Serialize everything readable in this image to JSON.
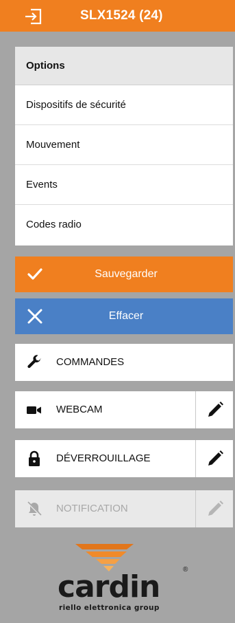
{
  "header": {
    "title": "SLX1524 (24)",
    "exit_icon": "exit-icon",
    "background": "#f07f1f"
  },
  "menu": {
    "heading": "Options",
    "items": [
      {
        "label": "Dispositifs de sécurité"
      },
      {
        "label": "Mouvement"
      },
      {
        "label": "Events"
      },
      {
        "label": "Codes radio"
      }
    ]
  },
  "actions": {
    "save_label": "Sauvegarder",
    "save_icon": "check-icon",
    "save_color": "#f07f1f",
    "clear_label": "Effacer",
    "clear_icon": "close-icon",
    "clear_color": "#4a80c6"
  },
  "rows": {
    "commands": {
      "label": "COMMANDES",
      "icon": "wrench-icon"
    },
    "webcam": {
      "label": "WEBCAM",
      "icon": "camera-icon",
      "edit_icon": "pencil-icon"
    },
    "unlock": {
      "label": "DÉVERROUILLAGE",
      "icon": "lock-icon",
      "edit_icon": "pencil-icon"
    },
    "notification": {
      "label": "NOTIFICATION",
      "icon": "bell-off-icon",
      "edit_icon": "pencil-icon",
      "disabled": true
    }
  },
  "logo": {
    "brand": "cardin",
    "tagline": "riello elettronica group",
    "registered": "®"
  }
}
